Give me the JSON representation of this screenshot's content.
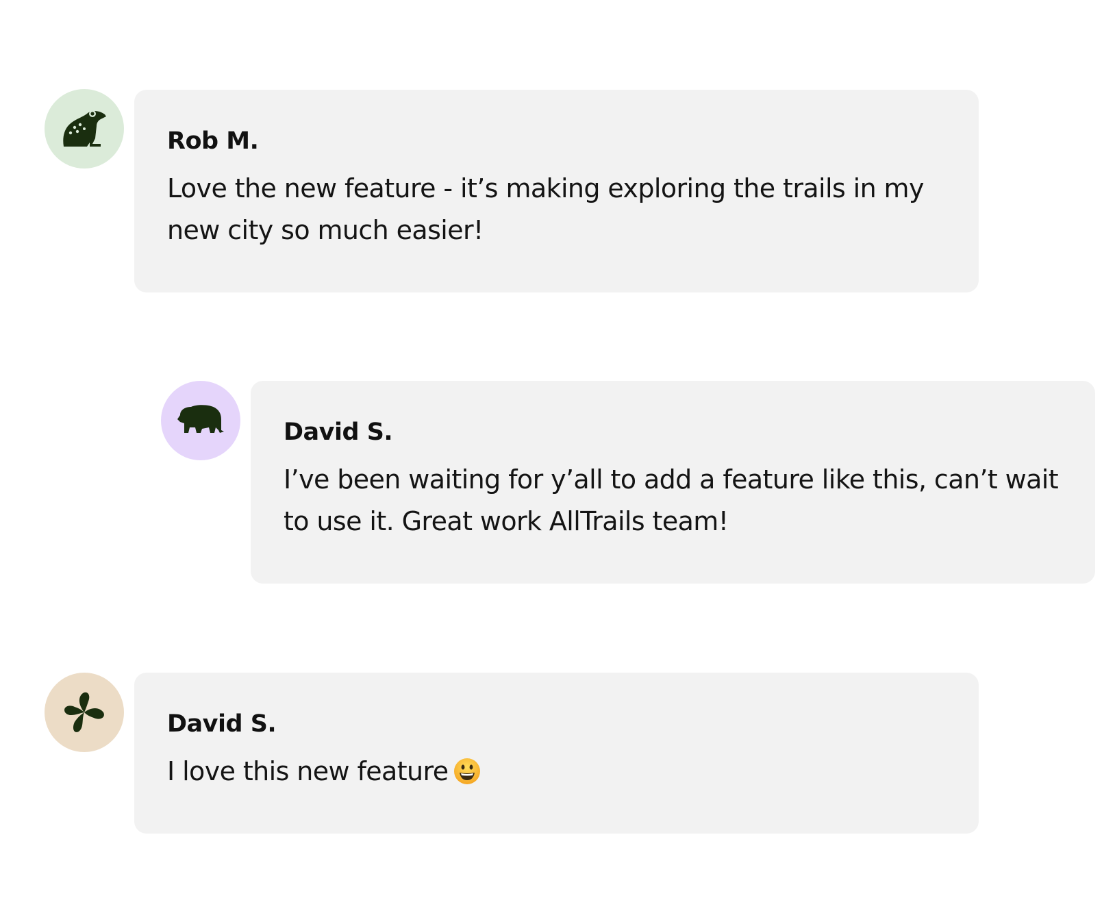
{
  "colors": {
    "bubble_background": "#f2f2f2",
    "icon_color": "#1a2e0f",
    "avatar_frog_bg": "#dbebd9",
    "avatar_bear_bg": "#e5d5fb",
    "avatar_clover_bg": "#ecdcc6"
  },
  "comments": [
    {
      "author": "Rob M.",
      "avatar_icon": "frog-icon",
      "text": "Love the new feature - it’s making exploring the trails in my new city so much easier!"
    },
    {
      "author": "David S.",
      "avatar_icon": "bear-icon",
      "text": "I’ve been waiting for y’all to add a feature like this, can’t wait to use it. Great work AllTrails team!"
    },
    {
      "author": "David S.",
      "avatar_icon": "clover-icon",
      "text": "I love this new feature",
      "emoji": "grinning-face-emoji"
    }
  ]
}
